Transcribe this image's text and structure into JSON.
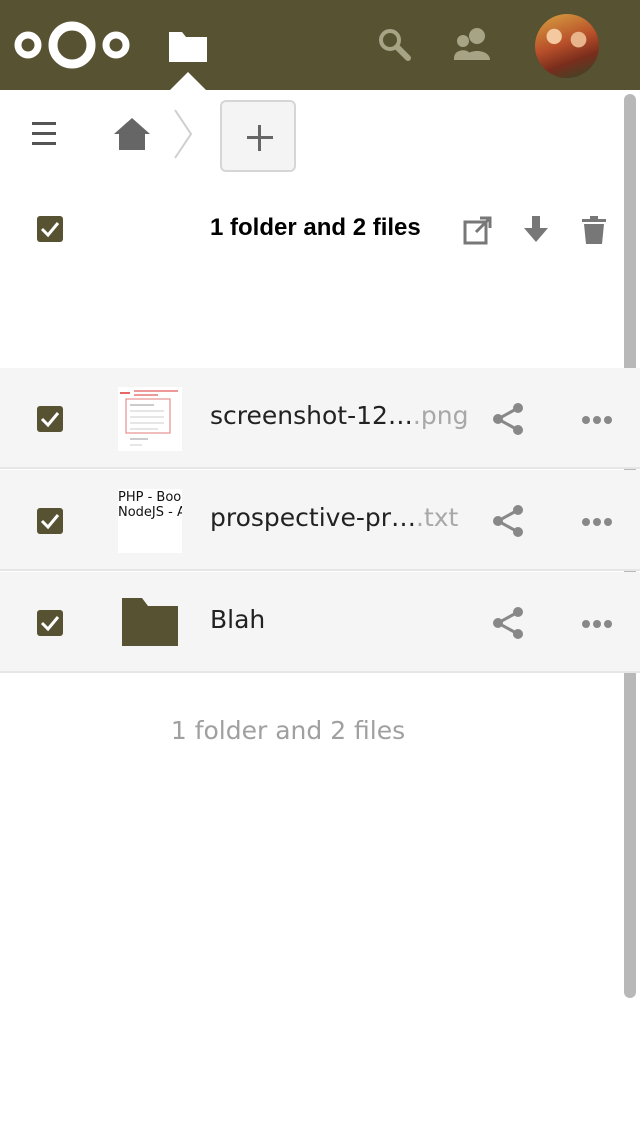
{
  "header": {
    "logo_icon": "nextcloud-logo-icon",
    "active_app_icon": "folder-icon",
    "search_icon": "search-icon",
    "contacts_icon": "contacts-icon",
    "avatar": "user-avatar",
    "background_color": "#575232"
  },
  "controls": {
    "menu_icon": "hamburger-menu-icon",
    "home_icon": "home-icon",
    "new_icon": "plus-icon"
  },
  "selection_bar": {
    "summary": "1 folder and 2 files",
    "actions": [
      "open-external-icon",
      "download-icon",
      "trash-icon"
    ]
  },
  "files": [
    {
      "name": "screenshot-12…",
      "ext": ".png",
      "type": "image",
      "selected": true
    },
    {
      "name": "prospective-pr…",
      "ext": ".txt",
      "type": "text",
      "preview_lines": [
        "PHP - Bool",
        "NodeJS - A"
      ],
      "selected": true
    },
    {
      "name": "Blah",
      "ext": "",
      "type": "folder",
      "selected": true
    }
  ],
  "footer": {
    "summary": "1 folder and 2 files"
  },
  "colors": {
    "accent": "#575232",
    "row_background": "#f5f5f5",
    "muted_text": "#a0a0a0"
  }
}
